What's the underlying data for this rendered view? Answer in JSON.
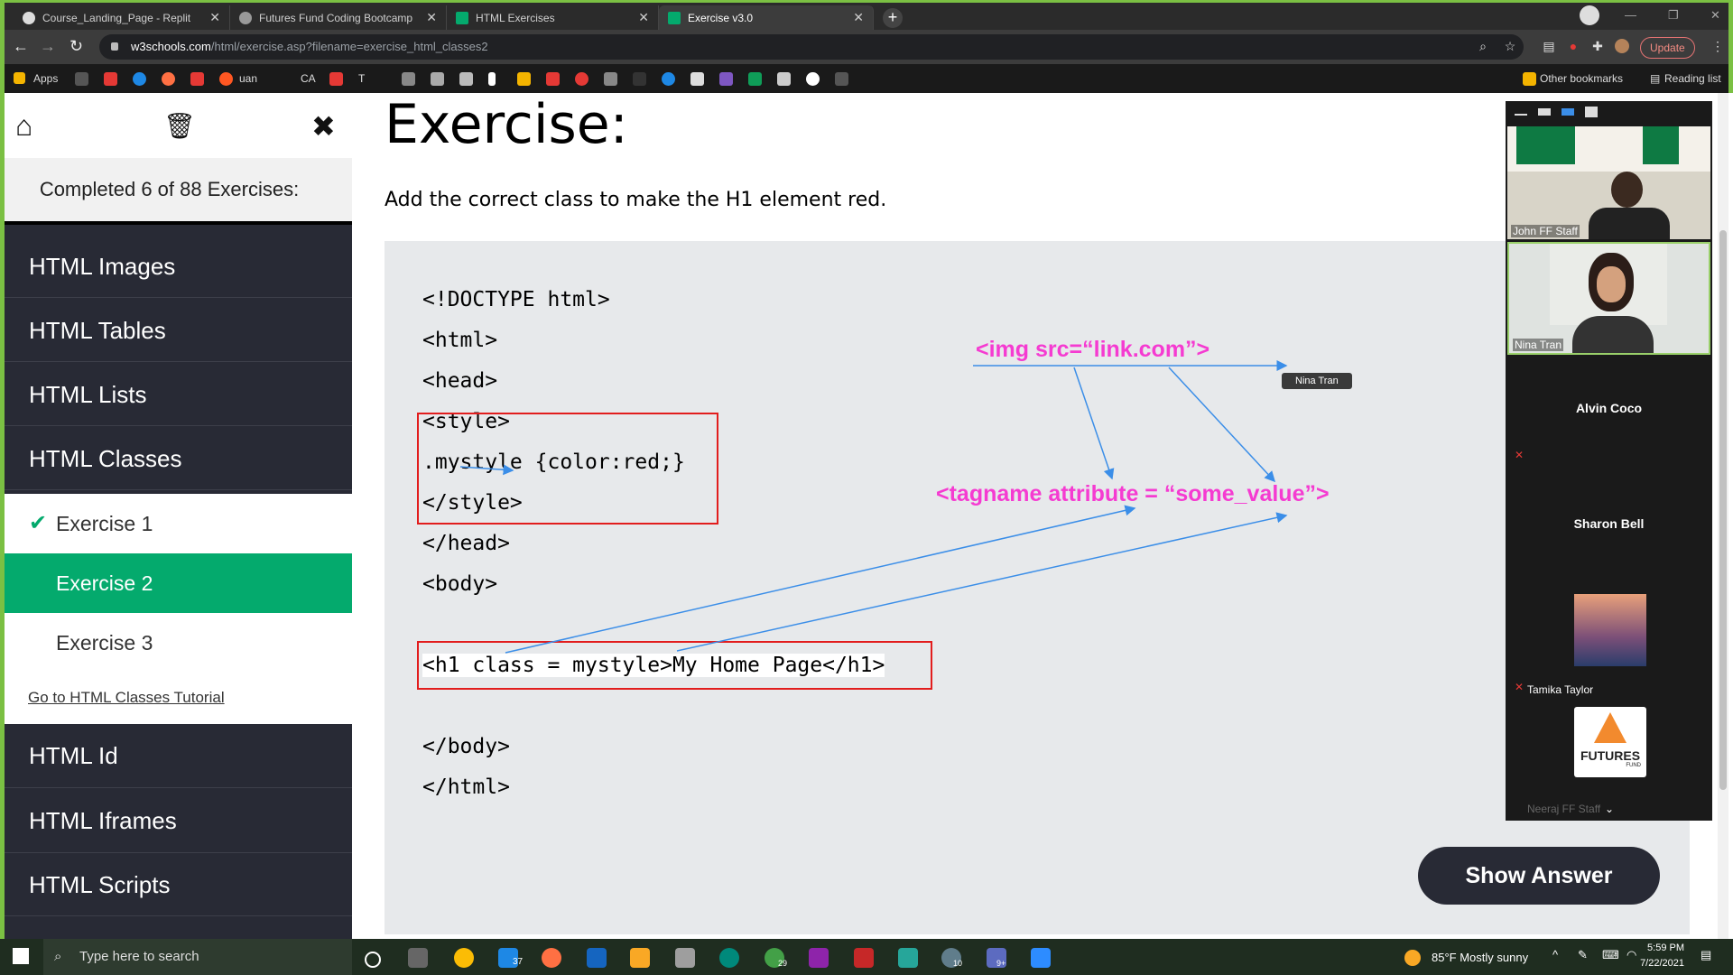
{
  "browser": {
    "tabs": [
      {
        "title": "Course_Landing_Page - Replit"
      },
      {
        "title": "Futures Fund Coding Bootcamp"
      },
      {
        "title": "HTML Exercises"
      },
      {
        "title": "Exercise v3.0"
      }
    ],
    "url_host": "w3schools.com",
    "url_path": "/html/exercise.asp?filename=exercise_html_classes2",
    "update_label": "Update",
    "bookmarks": {
      "apps_label": "Apps",
      "uan_label": "uan",
      "ca_label": "CA",
      "t_label": "T",
      "other_bookmarks": "Other bookmarks",
      "reading_list": "Reading list"
    }
  },
  "sidebar": {
    "progress": "Completed 6 of 88 Exercises:",
    "items_top": [
      "HTML Images",
      "HTML Tables",
      "HTML Lists",
      "HTML Classes"
    ],
    "exercises": [
      "Exercise 1",
      "Exercise 2",
      "Exercise 3"
    ],
    "tutorial_link": "Go to HTML Classes Tutorial",
    "items_bottom": [
      "HTML Id",
      "HTML Iframes",
      "HTML Scripts"
    ]
  },
  "main": {
    "title": "Exercise:",
    "description": "Add the correct class to make the H1 element red.",
    "code_lines": [
      "<!DOCTYPE html>",
      "<html>",
      "<head>",
      "<style>",
      ".mystyle {color:red;}",
      "</style>",
      "</head>",
      "<body>",
      "<h1 class = mystyle>My Home Page</h1>",
      "</body>",
      "</html>"
    ],
    "annotation_1": "<img src=“link.com”>",
    "annotation_2": "<tagname attribute = “some_value”>",
    "hover_label": "Nina Tran",
    "show_answer": "Show Answer"
  },
  "zoom": {
    "participants": [
      "John FF Staff",
      "Nina Tran",
      "Alvin Coco",
      "Sharon Bell",
      "Tamika Taylor",
      "Neeraj FF Staff"
    ],
    "logo_text": "FUTURES",
    "logo_sub": "FUND"
  },
  "taskbar": {
    "search_placeholder": "Type here to search",
    "badge_37": "37",
    "badge_29": "29",
    "badge_10": "10",
    "badge_9": "9+",
    "weather": "85°F  Mostly sunny",
    "time": "5:59 PM",
    "date": "7/22/2021"
  },
  "colors": {
    "accent_green": "#04aa6d",
    "annotation_pink": "#f53bd1",
    "sidebar_dark": "#282a35"
  }
}
